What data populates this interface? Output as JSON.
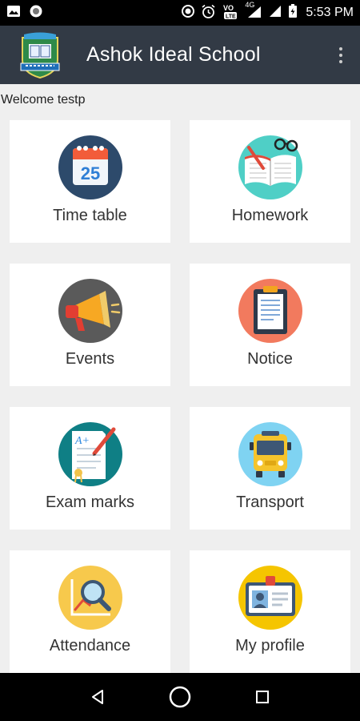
{
  "status_bar": {
    "time": "5:53 PM",
    "icons": [
      "image-icon",
      "circle-notification-icon",
      "data-saver-icon",
      "alarm-icon",
      "volte-icon",
      "4g-signal-icon",
      "signal-icon",
      "battery-icon"
    ],
    "network": "4G"
  },
  "app_bar": {
    "title": "Ashok Ideal School",
    "logo_icon": "school-crest-icon",
    "menu_icon": "overflow-menu-icon"
  },
  "welcome_text": "Welcome testp",
  "tiles": [
    {
      "label": "Time table",
      "icon": "calendar-icon"
    },
    {
      "label": "Homework",
      "icon": "book-icon"
    },
    {
      "label": "Events",
      "icon": "megaphone-icon"
    },
    {
      "label": "Notice",
      "icon": "clipboard-icon"
    },
    {
      "label": "Exam marks",
      "icon": "exam-paper-icon"
    },
    {
      "label": "Transport",
      "icon": "bus-icon"
    },
    {
      "label": "Attendance",
      "icon": "chart-magnifier-icon"
    },
    {
      "label": "My profile",
      "icon": "id-card-icon"
    }
  ],
  "calendar_day": "25",
  "exam_grade": "A+",
  "colors": {
    "app_bar": "#323a45",
    "background": "#efefef",
    "calendar_circle": "#2d4a6b",
    "homework_circle": "#4fcfc6",
    "events_circle": "#5a5a5a",
    "notice_circle": "#f27a5e",
    "exam_circle": "#0f7f85",
    "transport_circle": "#7fd3f2",
    "attendance_circle": "#f7c94c",
    "profile_circle": "#f5c500"
  },
  "nav": {
    "back_icon": "back-triangle-icon",
    "home_icon": "home-circle-icon",
    "recents_icon": "recents-square-icon"
  }
}
